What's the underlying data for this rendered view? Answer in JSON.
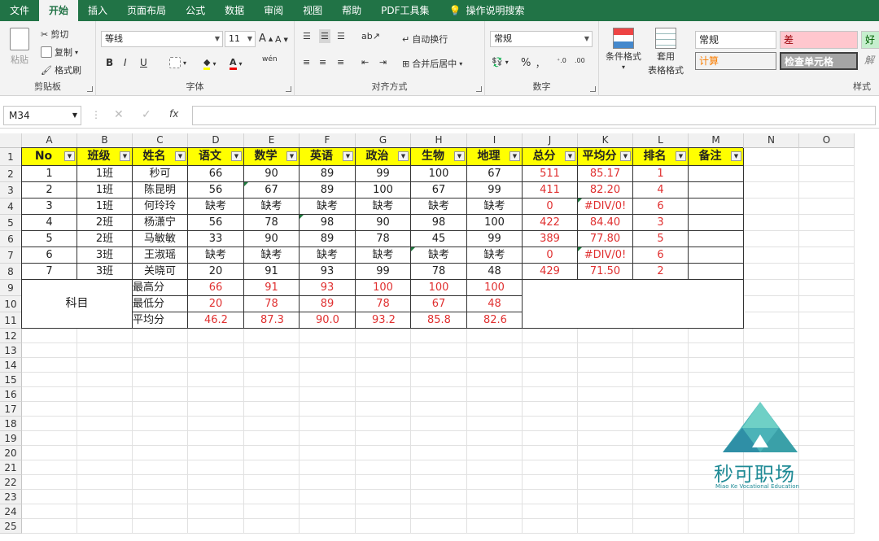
{
  "tabs": [
    "文件",
    "开始",
    "插入",
    "页面布局",
    "公式",
    "数据",
    "审阅",
    "视图",
    "帮助",
    "PDF工具集"
  ],
  "active_tab": "开始",
  "tell_me": "操作说明搜索",
  "clipboard": {
    "paste": "粘贴",
    "cut": "剪切",
    "copy": "复制",
    "format_painter": "格式刷",
    "label": "剪贴板"
  },
  "font": {
    "name": "等线",
    "size": "11",
    "bold": "B",
    "italic": "I",
    "underline": "U",
    "label": "字体",
    "grow": "A",
    "shrink": "A",
    "phonetic": "wén"
  },
  "alignment": {
    "wrap": "自动换行",
    "merge": "合并后居中",
    "label": "对齐方式"
  },
  "number": {
    "format": "常规",
    "percent": "%",
    "comma": "，",
    "label": "数字"
  },
  "styles": {
    "conditional": "条件格式",
    "table_format_1": "套用",
    "table_format_2": "表格格式",
    "normal": "常规",
    "bad": "差",
    "good": "好",
    "calc": "计算",
    "check": "检查单元格",
    "explain": "解",
    "label": "样式"
  },
  "name_box": "M34",
  "fx": "fx",
  "columns": [
    "A",
    "B",
    "C",
    "D",
    "E",
    "F",
    "G",
    "H",
    "I",
    "J",
    "K",
    "L",
    "M",
    "N",
    "O"
  ],
  "rows": [
    "1",
    "2",
    "3",
    "4",
    "5",
    "6",
    "7",
    "8",
    "9",
    "10",
    "11",
    "12",
    "13",
    "14",
    "15",
    "16",
    "17",
    "18",
    "19",
    "20",
    "21",
    "22",
    "23",
    "24",
    "25"
  ],
  "headers": [
    "No",
    "班级",
    "姓名",
    "语文",
    "数学",
    "英语",
    "政治",
    "生物",
    "地理",
    "总分",
    "平均分",
    "排名",
    "备注"
  ],
  "students": [
    [
      "1",
      "1班",
      "秒可",
      "66",
      "90",
      "89",
      "99",
      "100",
      "67",
      "511",
      "85.17",
      "1",
      ""
    ],
    [
      "2",
      "1班",
      "陈昆明",
      "56",
      "67",
      "89",
      "100",
      "67",
      "99",
      "411",
      "82.20",
      "4",
      ""
    ],
    [
      "3",
      "1班",
      "何玲玲",
      "缺考",
      "缺考",
      "缺考",
      "缺考",
      "缺考",
      "缺考",
      "0",
      "#DIV/0!",
      "6",
      ""
    ],
    [
      "4",
      "2班",
      "杨潇宁",
      "56",
      "78",
      "98",
      "90",
      "98",
      "100",
      "422",
      "84.40",
      "3",
      ""
    ],
    [
      "5",
      "2班",
      "马敏敏",
      "33",
      "90",
      "89",
      "78",
      "45",
      "99",
      "389",
      "77.80",
      "5",
      ""
    ],
    [
      "6",
      "3班",
      "王淑瑶",
      "缺考",
      "缺考",
      "缺考",
      "缺考",
      "缺考",
      "缺考",
      "0",
      "#DIV/0!",
      "6",
      ""
    ],
    [
      "7",
      "3班",
      "关晓可",
      "20",
      "91",
      "93",
      "99",
      "78",
      "48",
      "429",
      "71.50",
      "2",
      ""
    ]
  ],
  "summary_label": "科目",
  "summary": [
    {
      "label": "最高分",
      "values": [
        "66",
        "91",
        "93",
        "100",
        "100",
        "100"
      ]
    },
    {
      "label": "最低分",
      "values": [
        "20",
        "78",
        "89",
        "78",
        "67",
        "48"
      ]
    },
    {
      "label": "平均分",
      "values": [
        "46.2",
        "87.3",
        "90.0",
        "93.2",
        "85.8",
        "82.6"
      ]
    }
  ],
  "watermark": {
    "title": "秒可职场",
    "subtitle": "Miao Ke Vocational Education"
  },
  "colors": {
    "ribbon": "#217346",
    "header_fill": "#ffff00",
    "formula_red": "#e03030",
    "watermark": "#1e8a95"
  }
}
